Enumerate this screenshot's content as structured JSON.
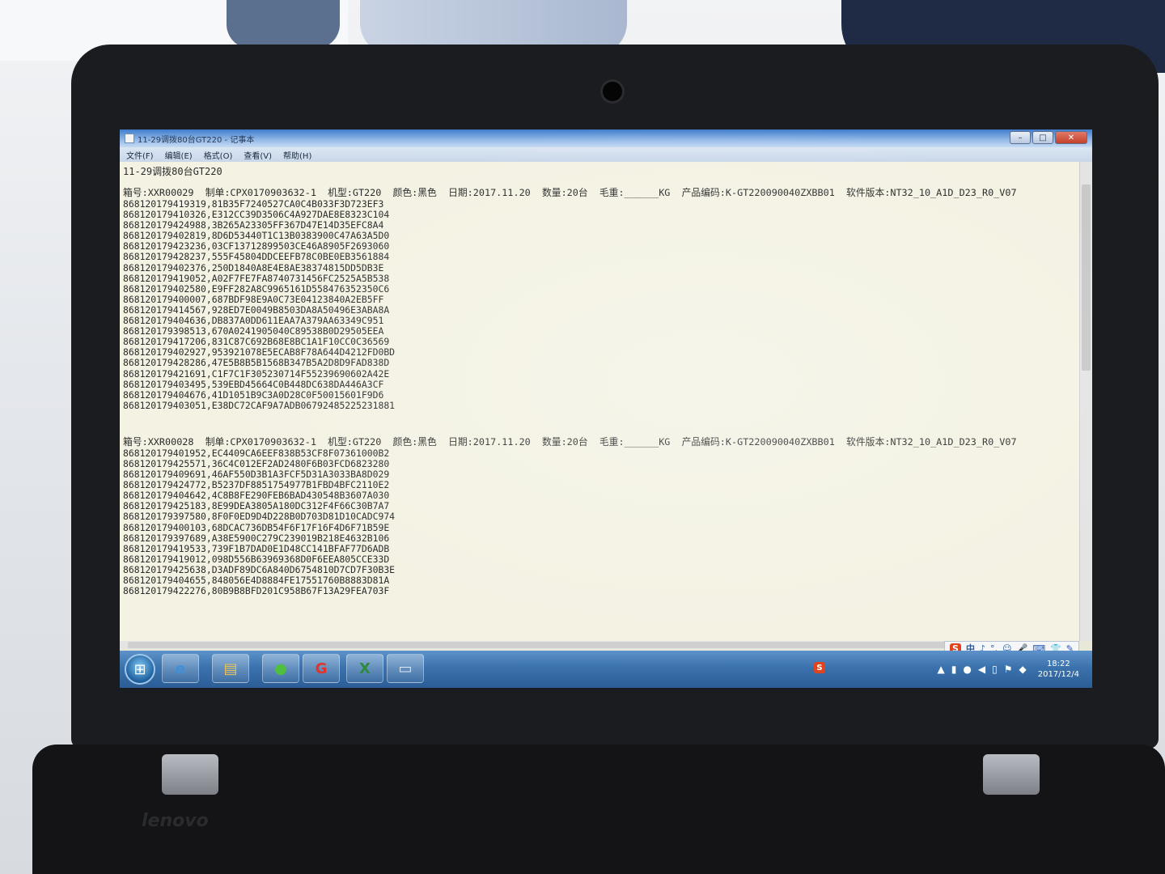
{
  "window": {
    "title": "11-29调拨80台GT220 - 记事本",
    "minimize": "–",
    "maximize": "□",
    "close": "✕"
  },
  "menu": [
    "文件(F)",
    "编辑(E)",
    "格式(O)",
    "查看(V)",
    "帮助(H)"
  ],
  "document": {
    "title_line": "11-29调拨80台GT220",
    "blocks": [
      {
        "header": "箱号:XXR00029  制单:CPX0170903632-1  机型:GT220  颜色:黑色  日期:2017.11.20  数量:20台  毛重:______KG  产品编码:K-GT220090040ZXBB01  软件版本:NT32_10_A1D_D23_R0_V07",
        "rows": [
          "868120179419319,81B35F7240527CA0C4B033F3D723EF3",
          "868120179410326,E312CC39D3506C4A927DAE8E8323C104",
          "868120179424988,3B265A23305FF367D47E14D35EFC8A4",
          "868120179402819,8D6D53440T1C13B0383900C47A63A5D0",
          "868120179423236,03CF13712899503CE46A8905F2693060",
          "868120179428237,555F45804DDCEEFB78C0BE0EB3561884",
          "868120179402376,250D1840A8E4E8AE38374815DD5DB3E",
          "868120179419052,A02F7FE7FA8740731456FC2525A5B538",
          "868120179402580,E9FF282A8C9965161D558476352350C6",
          "868120179400007,687BDF98E9A0C73E04123840A2EB5FF",
          "868120179414567,928ED7E0049B8503DA8A50496E3ABA8A",
          "868120179404636,DB837A0DD611EAA7A379AA63349C951",
          "868120179398513,670A0241905040C89538B0D29505EEA",
          "868120179417206,831C87C692B68E8BC1A1F10CC0C36569",
          "868120179402927,953921078E5ECAB8F78A644D4212FD0BD",
          "868120179428286,47E5B8B5B1568B347B5A2D8D9FAD838D",
          "868120179421691,C1F7C1F305230714F55239690602A42E",
          "868120179403495,539EBD45664C0B448DC638DA446A3CF",
          "868120179404676,41D1051B9C3A0D28C0F50015601F9D6",
          "868120179403051,E38DC72CAF9A7ADB06792485225231881"
        ]
      },
      {
        "header": "箱号:XXR00028  制单:CPX0170903632-1  机型:GT220  颜色:黑色  日期:2017.11.20  数量:20台  毛重:______KG  产品编码:K-GT220090040ZXBB01  软件版本:NT32_10_A1D_D23_R0_V07",
        "rows": [
          "868120179401952,EC4409CA6EEF838B53CF8F07361000B2",
          "868120179425571,36C4C012EF2AD2480F6B03FCD6823280",
          "868120179409691,46AF550D3B1A3FCF5D31A3033BA8D029",
          "868120179424772,B5237DF8851754977B1FBD4BFC2110E2",
          "868120179404642,4C8B8FE290FEB6BAD430548B3607A030",
          "868120179425183,8E99DEA3805A180DC312F4F66C30B7A7",
          "868120179397580,8F0F0ED9D4D228B0D703D81D10CADC974",
          "868120179400103,68DCAC736DB54F6F17F16F4D6F71B59E",
          "868120179397689,A38E5900C279C239019B218E4632B106",
          "868120179419533,739F1B7DAD0E1D48CC141BFAF77D6ADB",
          "868120179419012,098D556B63969368D0F6EEA805CCE33D",
          "868120179425638,D3ADF89DC6A840D6754810D7CD7F30B3E",
          "868120179404655,848056E4D8884FE17551760B8883D81A",
          "868120179422276,80B9B8BFD201C958B67F13A29FEA703F"
        ]
      }
    ]
  },
  "taskbar": {
    "start": "⊞",
    "apps": [
      {
        "icon": "ie-icon",
        "glyph": "e",
        "color": "#3f8fd8"
      },
      {
        "icon": "explorer-icon",
        "glyph": "▤",
        "color": "#e8c25a"
      },
      {
        "icon": "media-player-icon",
        "glyph": "●",
        "color": "#4fbf3f"
      },
      {
        "icon": "browser-g-icon",
        "glyph": "G",
        "color": "#e0342a"
      },
      {
        "icon": "excel-icon",
        "glyph": "X",
        "color": "#2f8a3f"
      },
      {
        "icon": "notepad-icon",
        "glyph": "▭",
        "color": "#dfe9f6"
      }
    ],
    "tray_sogou": "S",
    "clock_time": "18:22",
    "clock_date": "2017/12/4"
  },
  "ime": {
    "logo": "S",
    "mode": "中",
    "glyphs": [
      "♪",
      "°,",
      "☺",
      "🎤",
      "⌨",
      "👕",
      "✎"
    ]
  },
  "photo": {
    "laptop_brand": "lenovo"
  }
}
